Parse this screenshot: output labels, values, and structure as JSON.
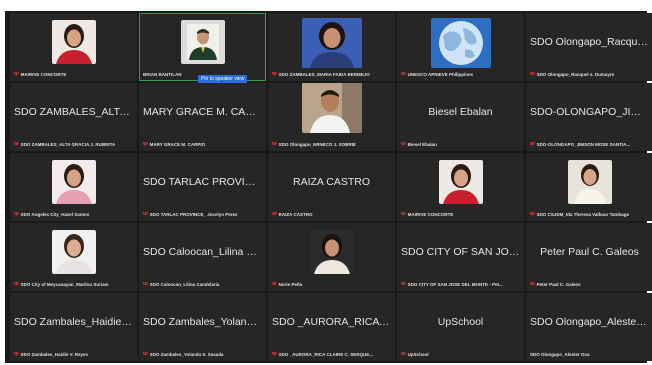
{
  "colors": {
    "background": "#1a1a1a",
    "tile": "#262626",
    "active_speaker": "#2f9e4b",
    "muted_mic": "#e5383b"
  },
  "tiles": [
    {
      "name": "",
      "label": "MAIRIVE CONCORTE",
      "photo": "woman-red"
    },
    {
      "name": "",
      "label": "BRIAN BANTILAN",
      "photo": "man-graduation"
    },
    {
      "name": "",
      "label": "SDO ZAMBALES_MARIA FAIDA BERMEJO",
      "photo": "woman-blue"
    },
    {
      "name": "",
      "label": "UNESCO APNIEVE Philippines",
      "photo": "globe"
    },
    {
      "name": "SDO Olongapo_Racquel s...",
      "label": "SDO Olongapo_Racquel s. Dumayre"
    },
    {
      "name": "SDO ZAMBALES_ALTA G...",
      "label": "SDO ZAMBALES_ALTA GRACIA J. RUBRITA"
    },
    {
      "name": "MARY GRACE M. CARPIO",
      "label": "MARY GRACE M. CARPIO"
    },
    {
      "name": "",
      "label": "SDO Olongapo_ERNECO J. SOBRIE",
      "photo": "man-video"
    },
    {
      "name": "Biesel Ebalan",
      "label": "Biesel Ebalan"
    },
    {
      "name": "SDO-OLONGAPO_JIMSO...",
      "label": "SDO-OLONGAPO_JIMSON MOSE SANTIA..."
    },
    {
      "name": "",
      "label": "SDO Angeles City_Hazel Santos",
      "photo": "woman-pink"
    },
    {
      "name": "SDO TARLAC PROVINCE...",
      "label": "SDO TARLAC PROVINCE_ Jocelyn Perez"
    },
    {
      "name": "RAIZA CASTRO",
      "label": "RAIZA CASTRO"
    },
    {
      "name": "",
      "label": "MAIRIVE CONCORTE",
      "photo": "woman-red"
    },
    {
      "name": "",
      "label": "SDO CSJDM_Ida Theresa Valbuar Tambaga",
      "photo": "woman-white"
    },
    {
      "name": "",
      "label": "SDO City of Meycauayan_Marilou Suriam",
      "photo": "woman-light"
    },
    {
      "name": "SDO Caloocan_Lilina Can...",
      "label": "SDO Caloocan_Lilina Candelaria"
    },
    {
      "name": "",
      "label": "Norie Peña",
      "photo": "woman-dark"
    },
    {
      "name": "SDO CITY OF SAN JOSE...",
      "label": "SDO CITY OF SAN JOSE DEL MONTE - Pet..."
    },
    {
      "name": "Peter Paul C. Galeos",
      "label": "Peter Paul C. Galeos"
    },
    {
      "name": "SDO Zambales_Haidie V...",
      "label": "SDO Zambales_Haidie V. Reyes"
    },
    {
      "name": "SDO Zambales_Yolanda S...",
      "label": "SDO Zambales_Yolanda S. Sasada"
    },
    {
      "name": "SDO _AURORA_RICA CL...",
      "label": "SDO _AURORA_RICA CLAIRE C. SERQUE..."
    },
    {
      "name": "UpSchool",
      "label": "UpSchool"
    },
    {
      "name": "SDO Olongapo_Alester Oca",
      "label": "SDO Olongapo_Alester Oca"
    }
  ],
  "pin_label": "Pin to speaker view"
}
